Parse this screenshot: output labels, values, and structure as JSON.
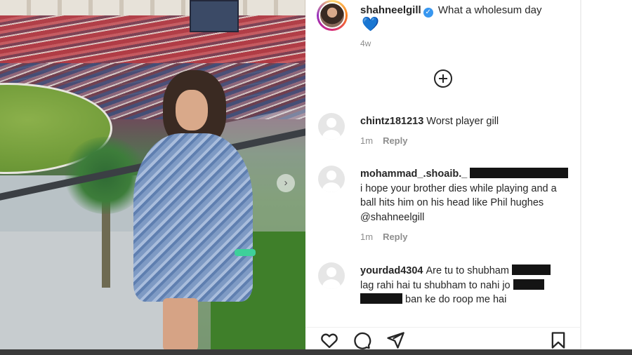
{
  "post": {
    "username": "shahneelgill",
    "caption": "What a wholesum day",
    "caption_emoji": "💙",
    "age": "4w"
  },
  "comments": [
    {
      "username": "chintz181213",
      "text": "Worst player gill",
      "time": "1m",
      "reply": "Reply"
    },
    {
      "username": "mohammad_.shoaib._",
      "text": "i hope your brother dies while playing and a ball hits him on his head like Phil hughes @shahneelgill",
      "time": "1m",
      "reply": "Reply"
    },
    {
      "username": "yourdad4304",
      "text_1": "Are tu to shubham",
      "text_2": "lag rahi hai tu shubham to nahi jo",
      "text_3": "ban ke do roop me hai"
    }
  ],
  "icons": {
    "verified": "verified-badge-icon",
    "add": "plus-circle-icon",
    "like": "heart-icon",
    "comment": "comment-icon",
    "share": "send-icon",
    "save": "bookmark-icon",
    "next": "chevron-right-icon"
  },
  "colors": {
    "verified": "#3897f0",
    "heart_emoji": "#3d6fd6",
    "muted_text": "#8e8e8e",
    "redaction": "#141414"
  }
}
